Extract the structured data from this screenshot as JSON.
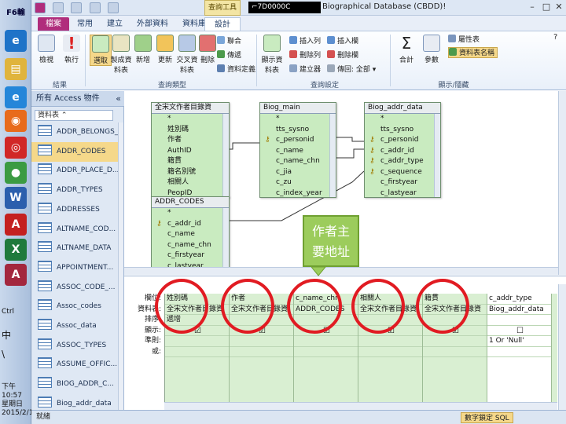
{
  "taskbar": {
    "start_label": "F6輸",
    "apps": [
      {
        "name": "ie-icon",
        "color": "#1e73c8",
        "glyph": "e"
      },
      {
        "name": "folder-icon",
        "color": "#e0b43c",
        "glyph": "▤"
      },
      {
        "name": "ie-icon-2",
        "color": "#2586d9",
        "glyph": "e"
      },
      {
        "name": "firefox-icon",
        "color": "#e86b1c",
        "glyph": "◉"
      },
      {
        "name": "target-icon",
        "color": "#d12727",
        "glyph": "◎"
      },
      {
        "name": "chrome-icon",
        "color": "#3b9b42",
        "glyph": "●"
      },
      {
        "name": "word-icon",
        "color": "#2b5fad",
        "glyph": "W"
      },
      {
        "name": "pdf-icon",
        "color": "#c42020",
        "glyph": "A"
      },
      {
        "name": "excel-icon",
        "color": "#1f7a3c",
        "glyph": "X"
      },
      {
        "name": "access-icon",
        "color": "#a3273e",
        "glyph": "A"
      }
    ],
    "texts": [
      "Ctrl",
      "中",
      "\\"
    ],
    "clock": [
      "下午 10:57",
      "星期日",
      "2015/2/1"
    ]
  },
  "titlebar": {
    "tools_tab": "查詢工具",
    "black_field": "⌐7D0000C",
    "app_title": "Biographical Database (CBDD)!",
    "win_controls": [
      "–",
      "□",
      "✕"
    ]
  },
  "ribbon_tabs": [
    "檔案",
    "常用",
    "建立",
    "外部資料",
    "資料庫工具",
    "設計"
  ],
  "ribbon": {
    "results_buttons": [
      "檢視",
      "執行"
    ],
    "querytype_buttons": [
      "選取",
      "製成資料表",
      "新增",
      "更新",
      "交叉資料表",
      "刪除"
    ],
    "querytype_small": [
      "聯合",
      "傳遞",
      "資料定義"
    ],
    "setup_big": "顯示資料表",
    "setup_small": [
      "插入列",
      "刪除列",
      "建立器",
      "插入欄",
      "刪除欄",
      "傳回: 全部"
    ],
    "totals_buttons": [
      "合計",
      "參數"
    ],
    "showhide_small": [
      "屬性表",
      "資料表名稱"
    ],
    "group_labels": [
      "結果",
      "查詢類型",
      "查詢設定",
      "顯示/隱藏"
    ]
  },
  "navpane": {
    "header": "所有 Access 物件",
    "chevron": "«",
    "search_label": "資料表",
    "items": [
      "ADDR_BELONGS_...",
      "ADDR_CODES",
      "ADDR_PLACE_D...",
      "ADDR_TYPES",
      "ADDRESSES",
      "ALTNAME_COD...",
      "ALTNAME_DATA",
      "APPOINTMENT...",
      "ASSOC_CODE_...",
      "Assoc_codes",
      "Assoc_data",
      "ASSOC_TYPES",
      "ASSUME_OFFIC...",
      "BIOG_ADDR_C...",
      "Biog_addr_data"
    ],
    "selected_index": 1
  },
  "tables": [
    {
      "title": "全宋文作者目錄資",
      "fields": [
        "*",
        "姓別碼",
        "作者",
        "AuthID",
        "籍貫",
        "籍名別號",
        "相關人",
        "PeopID"
      ]
    },
    {
      "title": "Biog_main",
      "fields": [
        "*",
        "tts_sysno",
        "c_personid",
        "c_name",
        "c_name_chn",
        "c_jia",
        "c_zu",
        "c_index_year"
      ]
    },
    {
      "title": "Biog_addr_data",
      "fields": [
        "*",
        "tts_sysno",
        "c_personid",
        "c_addr_id",
        "c_addr_type",
        "c_sequence",
        "c_firstyear",
        "c_lastyear"
      ]
    },
    {
      "title": "ADDR_CODES",
      "fields": [
        "*",
        "c_addr_id",
        "c_name",
        "c_name_chn",
        "c_firstyear",
        "c_lastyear"
      ]
    }
  ],
  "callout": {
    "line1": "作者主",
    "line2": "要地址"
  },
  "qbe": {
    "row_labels": [
      "欄位:",
      "資料表:",
      "排序:",
      "顯示:",
      "準則:",
      "或:"
    ],
    "columns": [
      {
        "field": "姓別碼",
        "table": "全宋文作者目錄資",
        "sort": "遞增",
        "show": "☑",
        "criteria": ""
      },
      {
        "field": "作者",
        "table": "全宋文作者目錄資",
        "sort": "",
        "show": "☑",
        "criteria": ""
      },
      {
        "field": "c_name_chn",
        "table": "ADDR_CODES",
        "sort": "",
        "show": "☑",
        "criteria": ""
      },
      {
        "field": "相關人",
        "table": "全宋文作者目錄資",
        "sort": "",
        "show": "☑",
        "criteria": ""
      },
      {
        "field": "籍貫",
        "table": "全宋文作者目錄資",
        "sort": "",
        "show": "☑",
        "criteria": ""
      },
      {
        "field": "c_addr_type",
        "table": "Biog_addr_data",
        "sort": "",
        "show": "☐",
        "criteria": "1 Or 'Null'"
      }
    ]
  },
  "statusbar": {
    "left": "就緒",
    "right": "數字鎖定 SQL"
  },
  "colors": {
    "access_accent": "#b02d7c",
    "table_green": "#c9ebc0",
    "callout_green": "#9ccc5c",
    "highlight_ring": "#e11b22"
  }
}
